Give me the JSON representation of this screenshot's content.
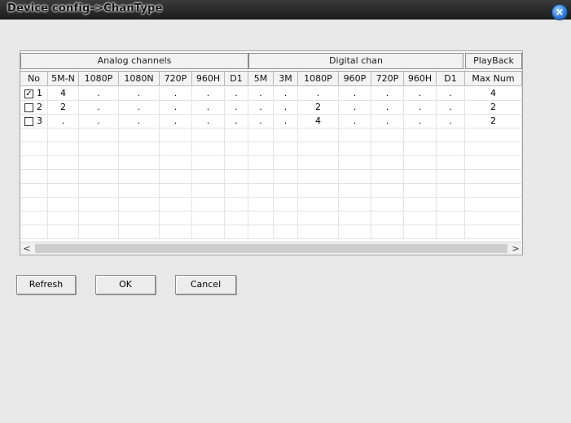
{
  "window": {
    "title": "Device config->ChanType",
    "close_icon": "close-icon"
  },
  "groups": {
    "analog": "Analog channels",
    "digital": "Digital chan",
    "playback": "PlayBack"
  },
  "columns": [
    "No",
    "5M-N",
    "1080P",
    "1080N",
    "720P",
    "960H",
    "D1",
    "5M",
    "3M",
    "1080P",
    "960P",
    "720P",
    "960H",
    "D1",
    "Max Num"
  ],
  "rows": [
    {
      "checked": true,
      "no": "1",
      "values": [
        "4",
        ".",
        ".",
        ".",
        ".",
        ".",
        ".",
        ".",
        ".",
        ".",
        ".",
        ".",
        ".",
        "4"
      ]
    },
    {
      "checked": false,
      "no": "2",
      "values": [
        "2",
        ".",
        ".",
        ".",
        ".",
        ".",
        ".",
        ".",
        "2",
        ".",
        ".",
        ".",
        ".",
        "2"
      ]
    },
    {
      "checked": false,
      "no": "3",
      "values": [
        ".",
        ".",
        ".",
        ".",
        ".",
        ".",
        ".",
        ".",
        "4",
        ".",
        ".",
        ".",
        ".",
        "2"
      ]
    }
  ],
  "buttons": {
    "refresh": "Refresh",
    "ok": "OK",
    "cancel": "Cancel"
  }
}
